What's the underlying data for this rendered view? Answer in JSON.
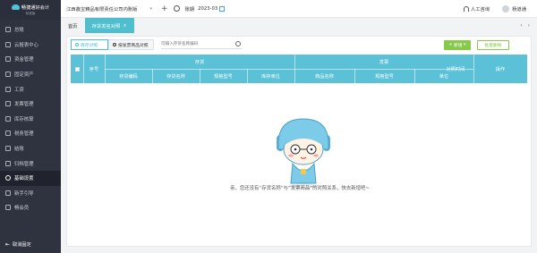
{
  "app": {
    "logo_text": "畅捷通好会计",
    "logo_sub": "标准版"
  },
  "sidebar": {
    "items": [
      {
        "label": "总账",
        "icon": "ledger-icon"
      },
      {
        "label": "云报表中心",
        "icon": "cloud-report-icon"
      },
      {
        "label": "资金管理",
        "icon": "money-icon"
      },
      {
        "label": "固定资产",
        "icon": "asset-icon"
      },
      {
        "label": "工资",
        "icon": "salary-icon"
      },
      {
        "label": "发票管理",
        "icon": "invoice-icon"
      },
      {
        "label": "库存核算",
        "icon": "inventory-icon"
      },
      {
        "label": "税务管理",
        "icon": "tax-icon"
      },
      {
        "label": "结账",
        "icon": "close-books-icon"
      },
      {
        "label": "归档管理",
        "icon": "archive-icon"
      },
      {
        "label": "基础设置",
        "icon": "settings-icon"
      },
      {
        "label": "新手引导",
        "icon": "guide-icon"
      },
      {
        "label": "畅会员",
        "icon": "member-icon"
      }
    ],
    "active_index": 10,
    "cancel_fix_label": "取消固定"
  },
  "topbar": {
    "company": "江西鑫宝精品有限责任公司内账版",
    "period_label": "账期",
    "period_value": "2023-03",
    "support_label": "人工咨询",
    "user_name": "杨道通"
  },
  "tabs": [
    {
      "label": "首页",
      "active": false
    },
    {
      "label": "存货发名对照",
      "active": true
    }
  ],
  "toolbar": {
    "segment_left": "库存对照",
    "segment_right": "按发票商品对照",
    "search_placeholder": "可输入存货名称编码",
    "new_button": "新增",
    "delete_button": "批量删除"
  },
  "table": {
    "index_header": "序号",
    "group_inventory": "存货",
    "group_invoice": "发票",
    "inventory_cols": [
      "存货编码",
      "存货名称",
      "规格型号",
      "库存单位"
    ],
    "invoice_cols": [
      "商品名称",
      "规格型号",
      "单位"
    ],
    "time_header": "对照时间",
    "action_header": "操作"
  },
  "empty_state": {
    "message": "亲，您还没有“存货名称”与“发票商品”的对照关系，快去新增吧~"
  },
  "colors": {
    "sidebar_bg": "#2f3340",
    "accent": "#5ac1d6",
    "new_button": "#87c949"
  }
}
